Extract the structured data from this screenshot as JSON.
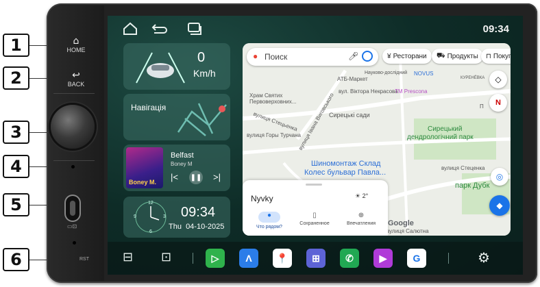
{
  "callouts": [
    "1",
    "2",
    "3",
    "4",
    "5",
    "6"
  ],
  "hardware": {
    "home_label": "HOME",
    "back_label": "BACK",
    "rst_label": "RST",
    "home_icon": "home-icon",
    "back_icon": "back-icon"
  },
  "statusbar": {
    "time": "09:34"
  },
  "speed_card": {
    "value": "0",
    "unit": "Km/h"
  },
  "nav_card": {
    "label": "Навігація"
  },
  "music_card": {
    "title": "Belfast",
    "artist": "Boney M",
    "album_text": "Boney M."
  },
  "clock_card": {
    "time": "09:34",
    "date": "Thu  04-10-2025",
    "dial_numbers": [
      "12",
      "3",
      "6",
      "9"
    ]
  },
  "map": {
    "search_placeholder": "Поиск",
    "chips": [
      "Ресторани",
      "Продукты",
      "Покупки"
    ],
    "labels": {
      "atb": "АТБ-Маркет",
      "naukovo": "Науково-дослідний",
      "novus": "NOVUS",
      "kurenivka": "КУРЕНЁВКА",
      "khram": "Храм Святих",
      "perevozh": "Первоверховних...",
      "nekrasova": "вул. Віктора Некрасова",
      "tm_prescona": "TM Prescona",
      "syrets_gardens": "Сирецькі сади",
      "st1": "вулиця Стецьенка",
      "st_gorky": "вулиця Горы Турчана",
      "vigorski": "вулиця Івана Виговського",
      "dendro1": "Сирецький",
      "dendro2": "дендрологічний парк",
      "tires1": "Шиномонтаж Склад",
      "tires2": "Колес бульвар Павла...",
      "st2": "вулиця Стеценка",
      "park_dub": "парк Дубк",
      "salyutna": "вулиця Салютна",
      "compass": "N",
      "pivnich": "П"
    },
    "sheet": {
      "place": "Nyvky",
      "weather": "2°",
      "tabs": [
        "Что рядом?",
        "Сохраненное",
        "Впечатления"
      ]
    },
    "google": "Google"
  },
  "dock": {
    "apps": [
      {
        "name": "carplay",
        "color": "#2fb24c",
        "glyph": "▷"
      },
      {
        "name": "nav",
        "color": "#2b7de9",
        "glyph": "Λ"
      },
      {
        "name": "maps",
        "color": "#ffffff",
        "glyph": "📍"
      },
      {
        "name": "apps-grid",
        "color": "#5d63d6",
        "glyph": "⊞"
      },
      {
        "name": "phone",
        "color": "#21a853",
        "glyph": "✆"
      },
      {
        "name": "play",
        "color": "#b03bd8",
        "glyph": "▶"
      },
      {
        "name": "google",
        "color": "#ffffff",
        "glyph": "G"
      }
    ]
  }
}
